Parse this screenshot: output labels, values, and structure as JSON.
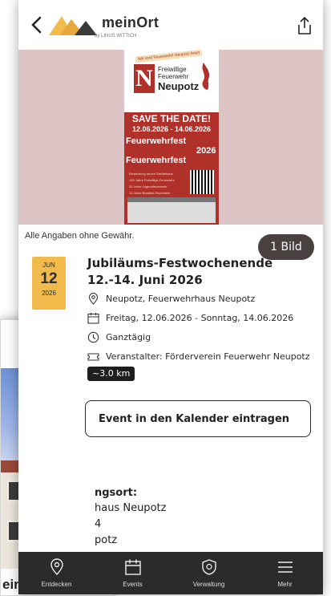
{
  "background_screenshot": {
    "caption": "einzabern"
  },
  "header": {
    "brand": "meinOrt",
    "brand_sub": "by LINUS WITTICH"
  },
  "poster": {
    "tag": "Wir sind Feuerwehr! Neupotz feiert",
    "logo_letter": "N",
    "org_line1": "Freiwillige",
    "org_line2": "Feuerwehr",
    "org_place": "Neupotz",
    "save_the_date": "SAVE THE DATE!",
    "dates": "12.06.2026 - 14.06.2026",
    "fest_word": "Feuerwehrfest",
    "fest_year": "2026",
    "fine_print": [
      "Einweihung neues Gerätehaus",
      "125 Jahre Freiwillige Feuerwehr",
      "50 Jahre Jugendfeuerwehr",
      "10 Jahre Bambini-Feuerwehr"
    ]
  },
  "hero": {
    "image_count_badge": "1 Bild"
  },
  "disclaimer": "Alle Angaben ohne Gewähr.",
  "event": {
    "date_box": {
      "month": "JUN",
      "day": "12",
      "year": "2026"
    },
    "title": "Jubiläums-Festwochenende 12.-14. Juni 2026",
    "location": "Neupotz, Feuerwehrhaus Neupotz",
    "date_range": "Freitag, 12.06.2026 - Sonntag, 14.06.2026",
    "time": "Ganztägig",
    "organizer": "Veranstalter: Förderverein Feuerwehr Neupotz",
    "distance": "~3.0 km",
    "calendar_button": "Event in den Kalender eintragen"
  },
  "venue": {
    "heading": "ngsort:",
    "line1": "haus Neupotz",
    "line2": "4",
    "line3": "potz"
  },
  "tabbar": {
    "items": [
      {
        "label": "Entdecken",
        "icon": "location-pin-icon"
      },
      {
        "label": "Events",
        "icon": "calendar-icon"
      },
      {
        "label": "Verwaltung",
        "icon": "shield-icon"
      },
      {
        "label": "Mehr",
        "icon": "menu-icon"
      }
    ]
  },
  "colors": {
    "accent": "#f0bb4a",
    "hero_bg": "#dcc5c4",
    "poster_red": "#b0302a",
    "tabbar_bg": "#2b2b2b"
  }
}
